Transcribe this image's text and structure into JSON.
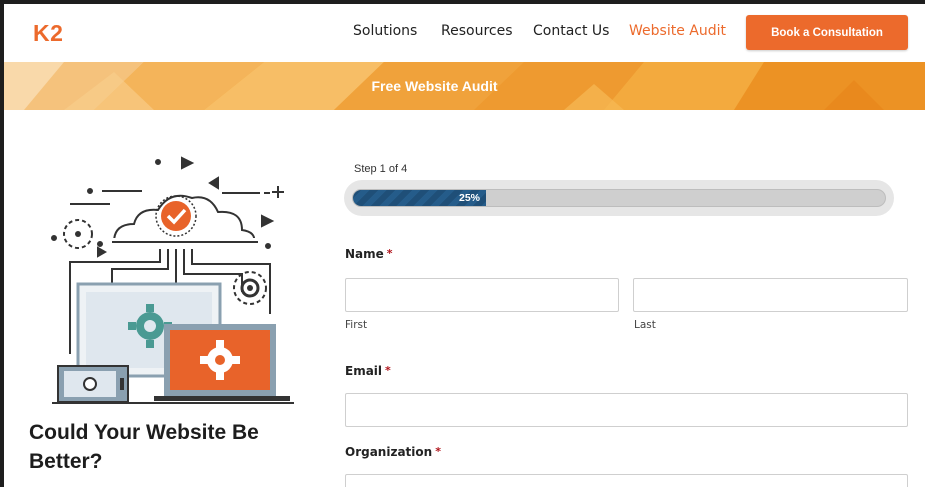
{
  "header": {
    "logo": "K2",
    "nav": [
      "Solutions",
      "Resources",
      "Contact Us",
      "Website Audit"
    ],
    "active_nav": "Website Audit",
    "cta_label": "Book a Consultation"
  },
  "banner": {
    "title": "Free Website Audit"
  },
  "hero": {
    "illustration": "website-optimization-illustration",
    "headline": "Could Your Website Be Better?"
  },
  "form": {
    "step_text": "Step 1 of 4",
    "progress_percent": 25,
    "progress_label": "25%",
    "name_label": "Name",
    "first_sublabel": "First",
    "last_sublabel": "Last",
    "email_label": "Email",
    "organization_label": "Organization",
    "required_marker": "*"
  },
  "colors": {
    "brand": "#ec6a2c",
    "progress": "#1f4f78",
    "required": "#b0141b"
  }
}
